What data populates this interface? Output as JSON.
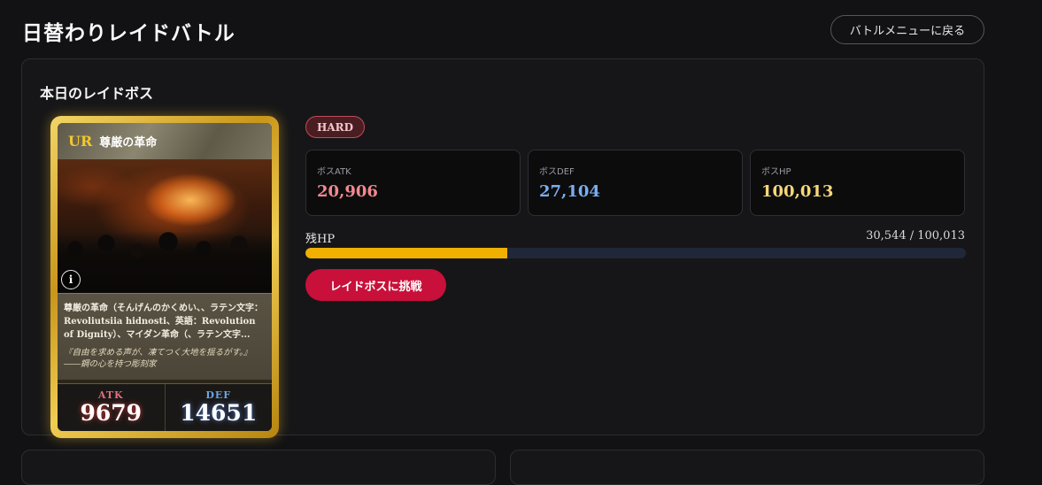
{
  "header": {
    "title": "日替わりレイドバトル",
    "back_label": "バトルメニューに戻る"
  },
  "raid": {
    "section_title": "本日のレイドボス",
    "difficulty": "HARD",
    "stats": [
      {
        "label": "ボスATK",
        "value": "20,906",
        "color": "#f2888f"
      },
      {
        "label": "ボスDEF",
        "value": "27,104",
        "color": "#7aaef0"
      },
      {
        "label": "ボスHP",
        "value": "100,013",
        "color": "#f5d77a"
      }
    ],
    "hp_label": "残HP",
    "hp_text": "30,544 / 100,013",
    "hp_current": 30544,
    "hp_max": 100013,
    "challenge_label": "レイドボスに挑戦"
  },
  "card": {
    "rarity": "UR",
    "name": "尊厳の革命",
    "info_icon": "i",
    "description": "尊厳の革命（そんげんのかくめい、、ラテン文字：Revoliutsiia hidnosti、英語：Revolution of Dignity）、マイダン革命（、ラテン文字...",
    "flavor": "『自由を求める声が、凍てつく大地を揺るがす。』――鋼の心を持つ彫刻家",
    "atk_label": "ATK",
    "atk_value": "9679",
    "def_label": "DEF",
    "def_value": "14651"
  }
}
